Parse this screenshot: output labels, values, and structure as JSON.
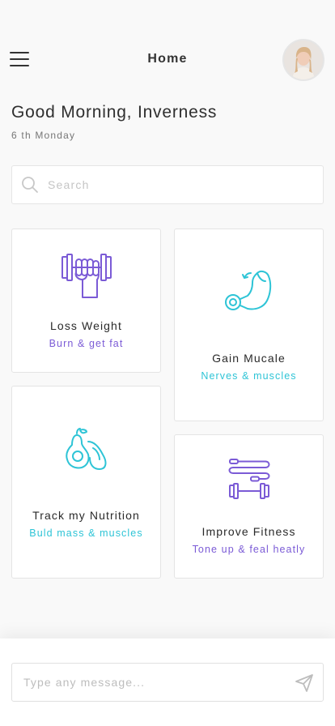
{
  "header": {
    "title": "Home",
    "menu_icon": "hamburger-menu-icon",
    "avatar_icon": "user-avatar"
  },
  "greeting": "Good Morning, Inverness",
  "date": "6 th Monday",
  "search": {
    "placeholder": "Search",
    "icon": "search-icon"
  },
  "colors": {
    "purple": "#7b5bd6",
    "teal": "#2ec4d6",
    "text": "#2b2b2b"
  },
  "cards": [
    {
      "title": "Loss Weight",
      "subtitle": "Burn & get fat",
      "icon": "dumbbell-fist-icon",
      "accent": "#7b5bd6"
    },
    {
      "title": "Gain Mucale",
      "subtitle": "Nerves & muscles",
      "icon": "flexed-arm-icon",
      "accent": "#2ec4d6"
    },
    {
      "title": "Track my Nutrition",
      "subtitle": "Buld mass & muscles",
      "icon": "avocado-pear-icon",
      "accent": "#2ec4d6"
    },
    {
      "title": "Improve Fitness",
      "subtitle": "Tone up & feal heatly",
      "icon": "jump-rope-barbell-icon",
      "accent": "#7b5bd6"
    }
  ],
  "composer": {
    "placeholder": "Type any message...",
    "send_icon": "send-paper-plane-icon"
  }
}
